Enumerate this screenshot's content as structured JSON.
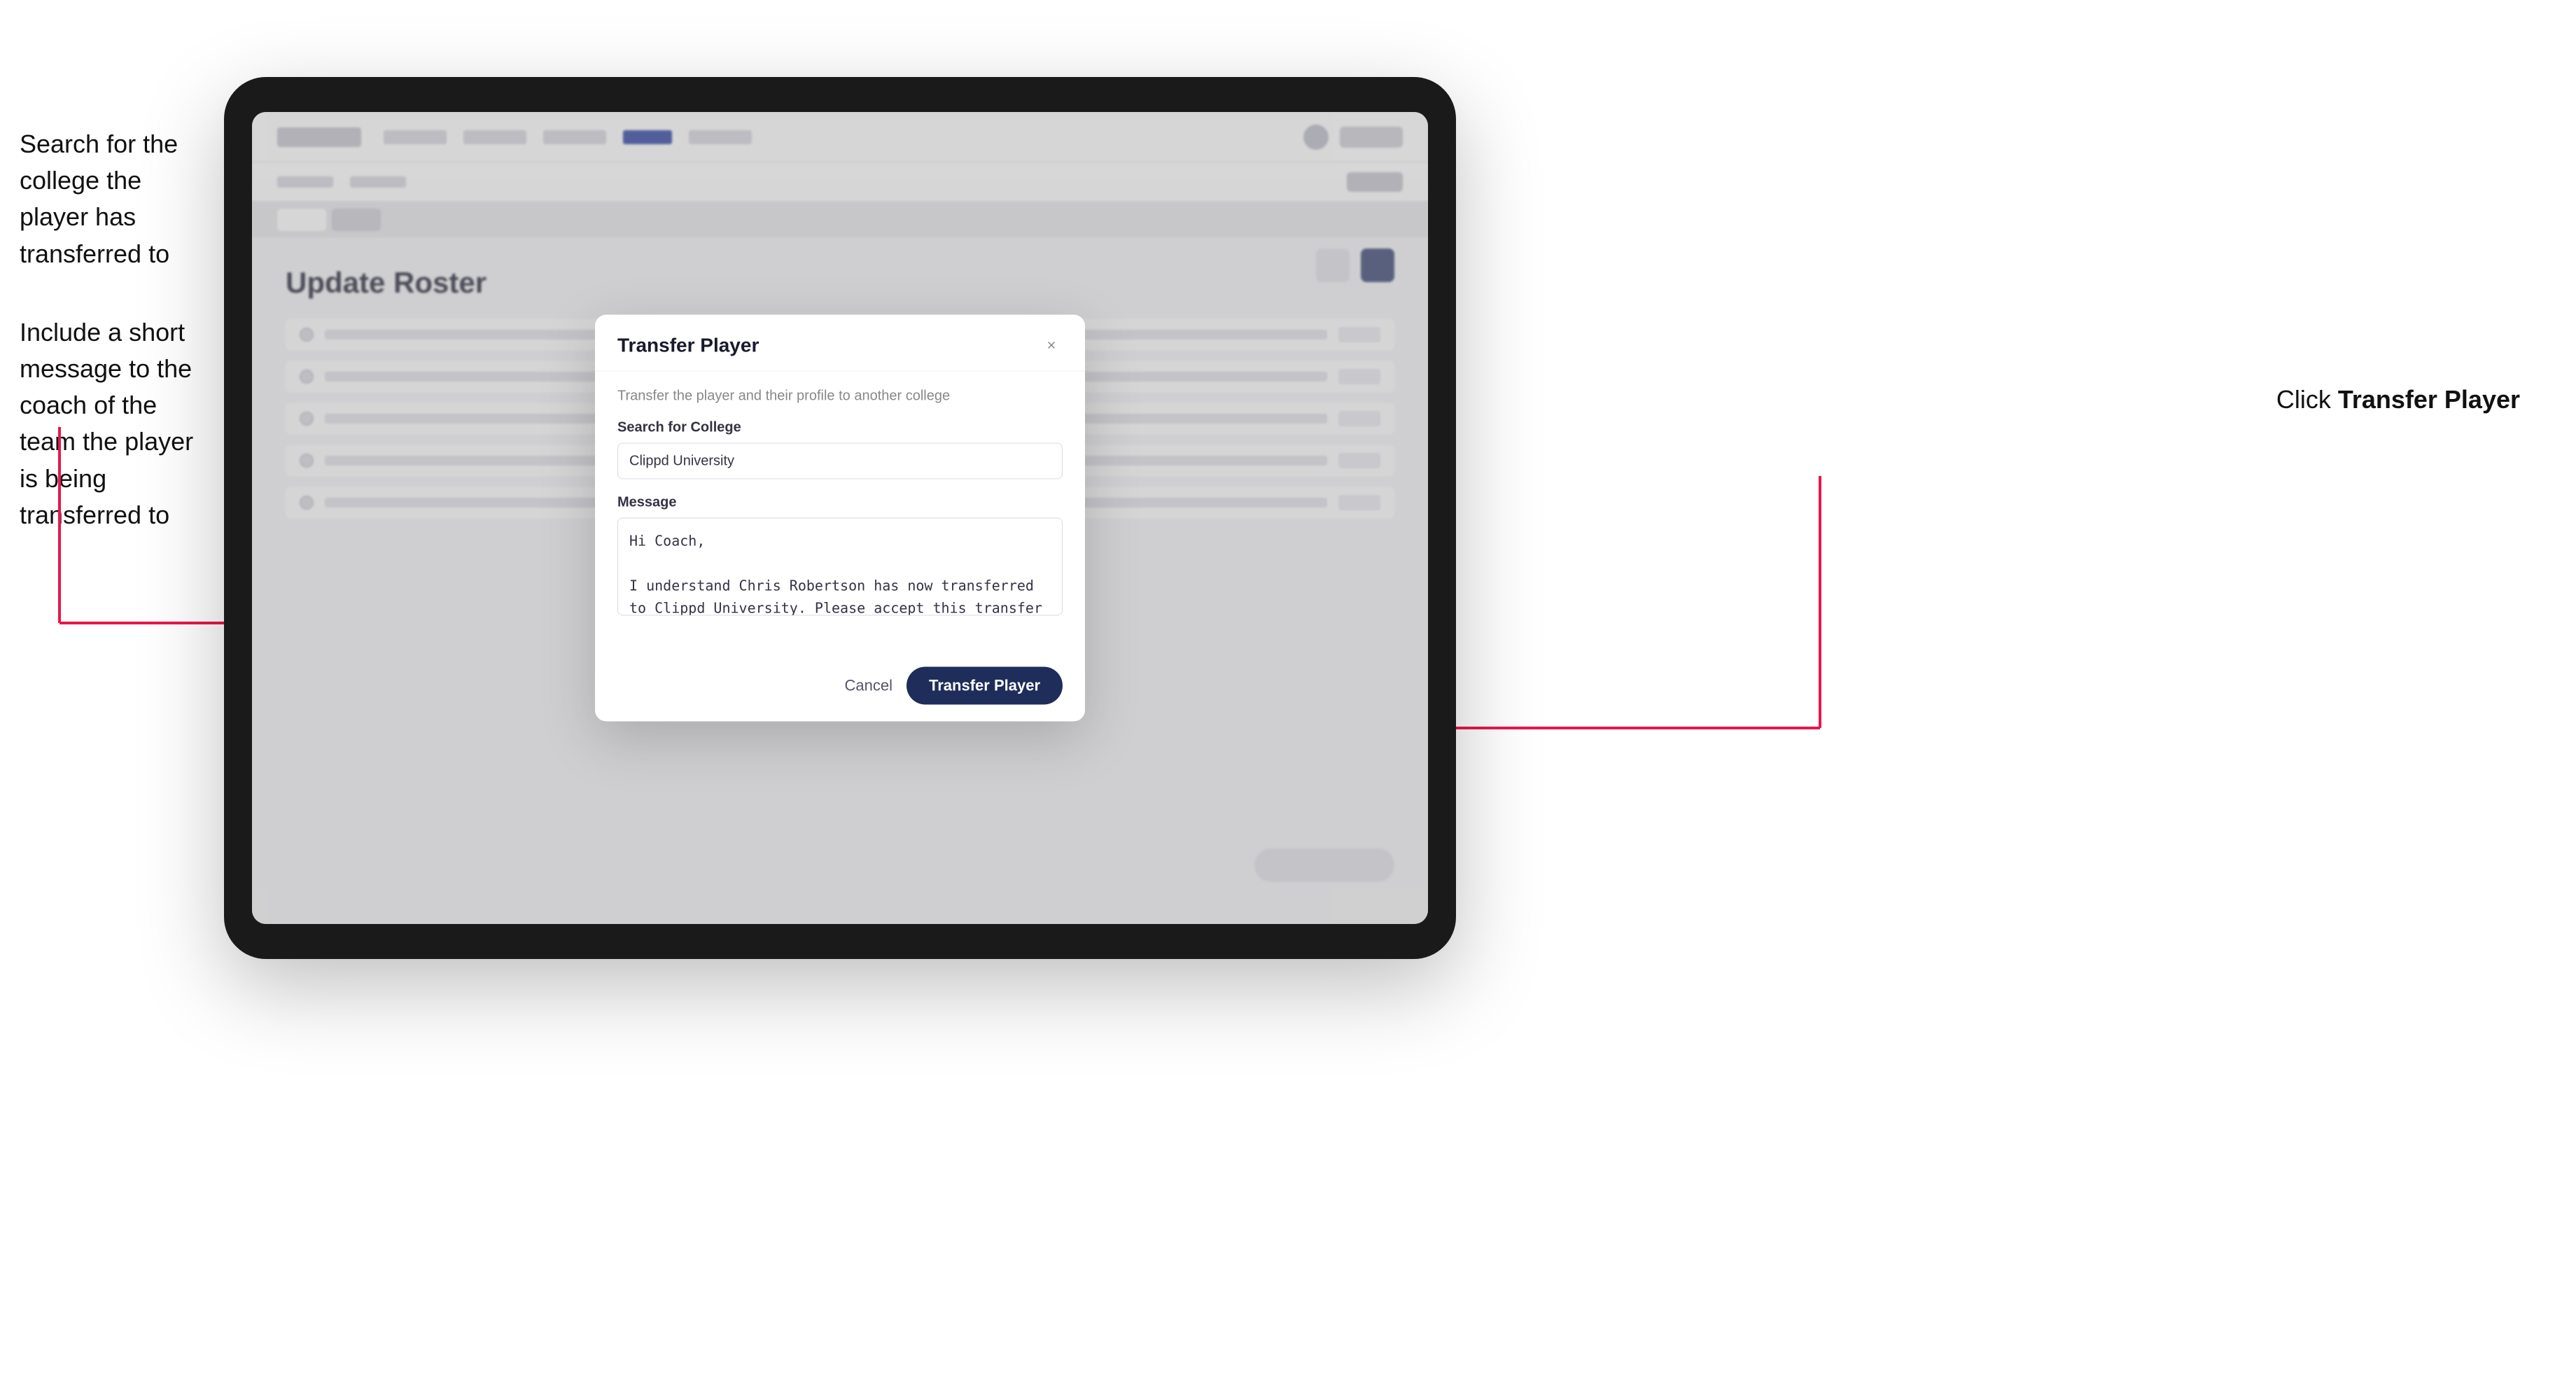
{
  "annotations": {
    "left_top": "Search for the college the player has transferred to",
    "left_bottom": "Include a short message to the coach of the team the player is being transferred to",
    "right": "Click ",
    "right_bold": "Transfer Player"
  },
  "modal": {
    "title": "Transfer Player",
    "subtitle": "Transfer the player and their profile to another college",
    "search_label": "Search for College",
    "search_value": "Clippd University",
    "message_label": "Message",
    "message_value": "Hi Coach,\n\nI understand Chris Robertson has now transferred to Clippd University. Please accept this transfer request when you can.",
    "cancel_label": "Cancel",
    "transfer_label": "Transfer Player",
    "close_icon": "×"
  },
  "app": {
    "content_title": "Update Roster"
  }
}
